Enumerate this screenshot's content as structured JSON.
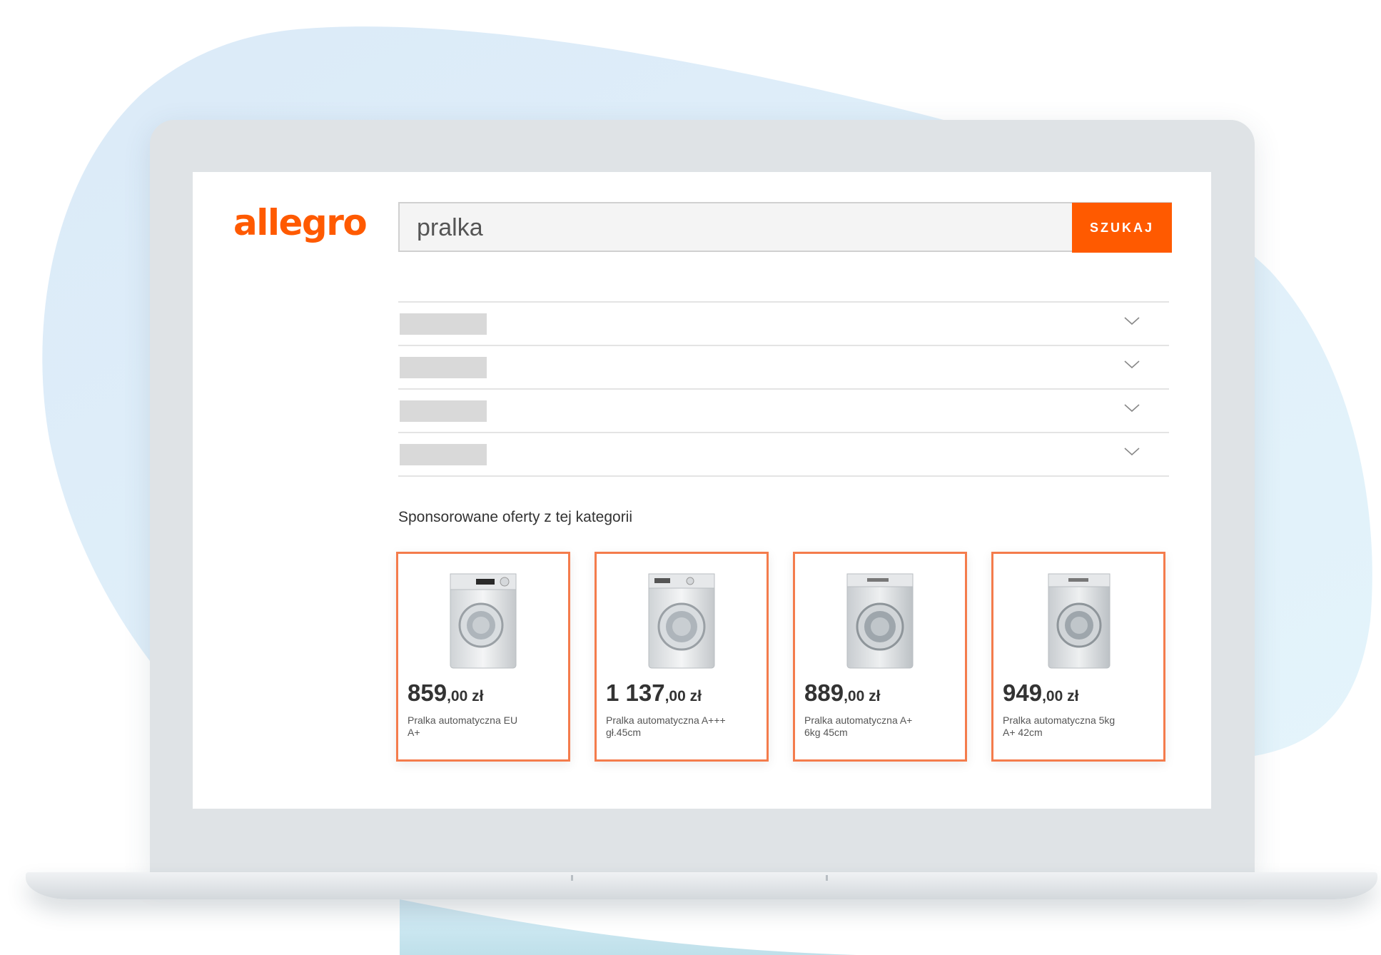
{
  "brand": {
    "logo_text": "allegro",
    "accent_color": "#ff5a00"
  },
  "search": {
    "query": "pralka",
    "button_label": "SZUKAJ"
  },
  "filters": [
    {
      "icon": "chevron-down-icon"
    },
    {
      "icon": "chevron-down-icon"
    },
    {
      "icon": "chevron-down-icon"
    },
    {
      "icon": "chevron-down-icon"
    }
  ],
  "sponsored": {
    "title": "Sponsorowane oferty z tej kategorii",
    "offers": [
      {
        "price_main": "859",
        "price_rest": ",00 zł",
        "desc_line1": "Pralka automatyczna EU",
        "desc_line2": "A+",
        "icon": "washing-machine-icon"
      },
      {
        "price_main": "1 137",
        "price_rest": ",00 zł",
        "desc_line1": "Pralka automatyczna A+++",
        "desc_line2": "gł.45cm",
        "icon": "washing-machine-icon"
      },
      {
        "price_main": "889",
        "price_rest": ",00 zł",
        "desc_line1": "Pralka automatyczna A+",
        "desc_line2": "6kg 45cm",
        "icon": "washing-machine-icon"
      },
      {
        "price_main": "949",
        "price_rest": ",00 zł",
        "desc_line1": "Pralka automatyczna 5kg",
        "desc_line2": "A+ 42cm",
        "icon": "washing-machine-icon"
      }
    ]
  }
}
